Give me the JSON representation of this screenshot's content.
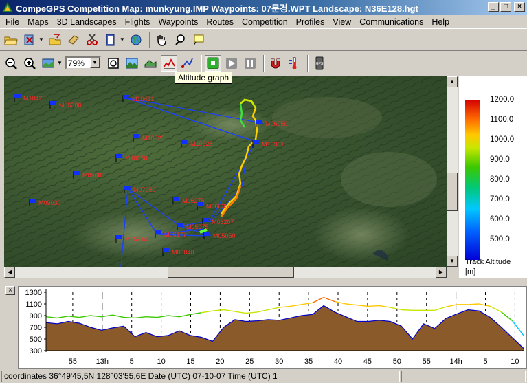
{
  "window": {
    "title": "CompeGPS Competition Map: munkyung.IMP Waypoints:  07문경.WPT Landscape: N36E128.hgt",
    "buttons": {
      "minimize": "_",
      "maximize": "□",
      "close": "×"
    }
  },
  "menu": [
    "File",
    "Maps",
    "3D Landscapes",
    "Flights",
    "Waypoints",
    "Routes",
    "Competition",
    "Profiles",
    "View",
    "Communications",
    "Help"
  ],
  "toolbar1": {
    "icons": [
      "open-folder-icon",
      "cut-icon",
      "open-map-icon",
      "edit-map-icon",
      "scissors-icon",
      "notebook-icon",
      "globe-icon",
      "hand-pan-icon",
      "zoom-hand-icon",
      "note-icon"
    ]
  },
  "toolbar2": {
    "zoom_value": "79%",
    "icons": [
      "zoom-out-icon",
      "zoom-in-icon",
      "map-view-icon",
      "fullscreen-icon",
      "landscape-icon",
      "3d-icon",
      "altitude-graph-icon",
      "route-icon",
      "play-green-icon",
      "play-icon",
      "pause-icon",
      "magnet-icon",
      "thermometer-icon",
      "gps-icon"
    ],
    "gps_label": "GPS"
  },
  "tooltip": "Altitude graph",
  "map": {
    "waypoints": [
      {
        "label": "M10420"
      },
      {
        "label": "M05380"
      },
      {
        "label": "M10431"
      },
      {
        "label": "M06050"
      },
      {
        "label": "M10301"
      },
      {
        "label": "M10325"
      },
      {
        "label": "M10228"
      },
      {
        "label": "M10150"
      },
      {
        "label": "M09085"
      },
      {
        "label": "M07080"
      },
      {
        "label": "M09030"
      },
      {
        "label": "M06275"
      },
      {
        "label": "M06035"
      },
      {
        "label": "M06207"
      },
      {
        "label": "M05075"
      },
      {
        "label": "M06177"
      },
      {
        "label": "M05060"
      },
      {
        "label": "M05214"
      },
      {
        "label": "M06040"
      }
    ]
  },
  "legend": {
    "ticks": [
      "1200.0",
      "1100.0",
      "1000.0",
      "900.0",
      "800.0",
      "700.0",
      "600.0",
      "500.0"
    ],
    "caption": [
      "Track Altitude",
      "[m]"
    ]
  },
  "graph": {
    "y_ticks": [
      "1300",
      "1100",
      "900",
      "700",
      "500",
      "300"
    ],
    "x_ticks": [
      "55",
      "13h",
      "5",
      "10",
      "15",
      "20",
      "25",
      "30",
      "35",
      "40",
      "45",
      "50",
      "55",
      "14h",
      "5",
      "10"
    ],
    "colors": {
      "ground": "#8b5a2b",
      "track_outline": "#0000c8"
    },
    "close_label": "×"
  },
  "status": {
    "text": "coordinates 36°49'45,5N 128°03'55,6E Date (UTC) 07-10-07 Time (UTC) 1"
  },
  "chart_data": {
    "type": "area",
    "title": "",
    "xlabel": "",
    "ylabel": "",
    "ylim": [
      300,
      1300
    ],
    "x_ticks": [
      "55",
      "13h",
      "5",
      "10",
      "15",
      "20",
      "25",
      "30",
      "35",
      "40",
      "45",
      "50",
      "55",
      "14h",
      "5",
      "10"
    ],
    "series": [
      {
        "values": [
          880,
          860,
          890,
          870,
          900,
          880,
          910,
          870,
          860,
          880,
          870,
          900,
          880,
          920,
          950,
          980,
          1000,
          970,
          940,
          960,
          1000,
          1040,
          1060,
          1090,
          1120,
          1210,
          1140,
          1100,
          1080,
          1060,
          1070,
          1040,
          1000,
          990,
          990,
          990,
          1050,
          1090,
          1090,
          1100,
          1060,
          960,
          810,
          560
        ]
      },
      {
        "values": [
          780,
          760,
          800,
          770,
          700,
          650,
          690,
          720,
          540,
          610,
          540,
          560,
          640,
          560,
          530,
          460,
          700,
          830,
          800,
          810,
          830,
          820,
          860,
          900,
          920,
          1070,
          960,
          880,
          800,
          800,
          820,
          800,
          720,
          500,
          760,
          680,
          850,
          930,
          1000,
          980,
          870,
          700,
          520,
          340
        ]
      }
    ]
  }
}
